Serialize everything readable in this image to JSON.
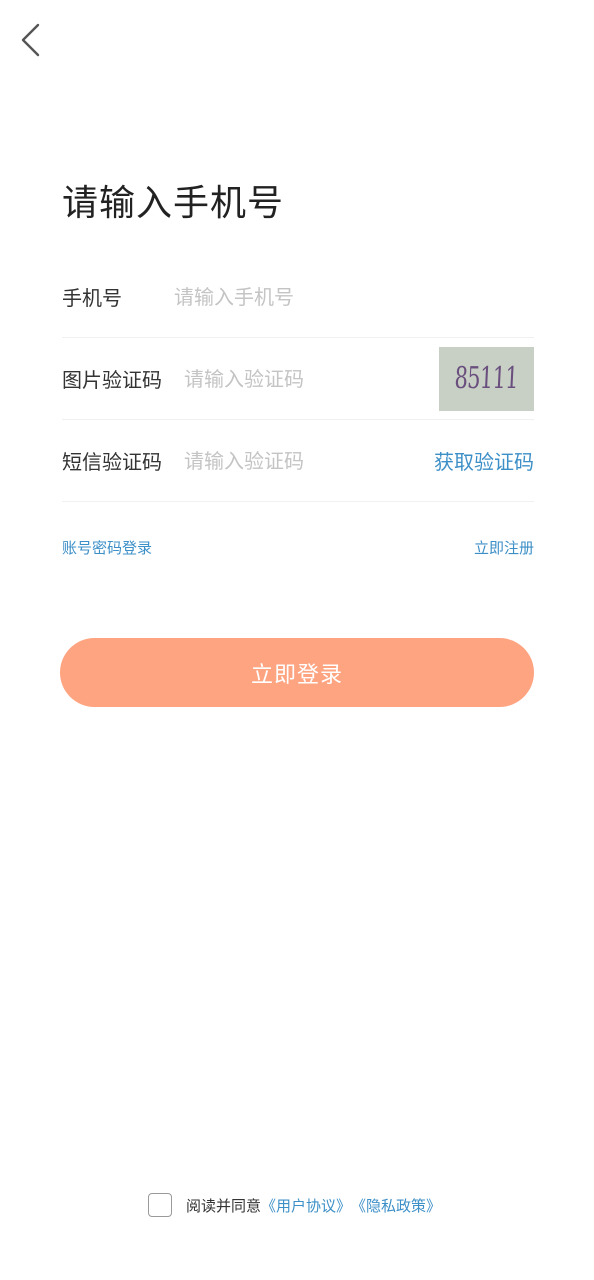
{
  "header": {
    "back_icon": "chevron-left-icon"
  },
  "title": "请输入手机号",
  "form": {
    "phone": {
      "label": "手机号",
      "placeholder": "请输入手机号",
      "value": ""
    },
    "image_captcha": {
      "label": "图片验证码",
      "placeholder": "请输入验证码",
      "value": "",
      "captcha_text": "85111"
    },
    "sms_code": {
      "label": "短信验证码",
      "placeholder": "请输入验证码",
      "value": "",
      "get_code_label": "获取验证码"
    }
  },
  "links": {
    "password_login": "账号密码登录",
    "register": "立即注册"
  },
  "login_button": "立即登录",
  "agreement": {
    "checked": false,
    "prefix": "阅读并同意",
    "user_agreement": "《用户协议》",
    "privacy_policy": "《隐私政策》"
  },
  "colors": {
    "accent": "#3d8fc7",
    "button": "#fea481",
    "captcha_bg": "#c8d0c6"
  }
}
